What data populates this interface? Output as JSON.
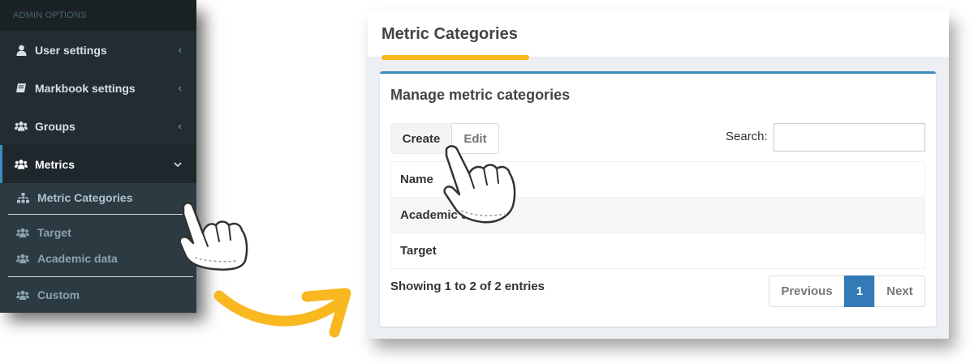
{
  "sidebar": {
    "header": "ADMIN OPTIONS",
    "items": [
      {
        "label": "User settings",
        "icon": "user-icon"
      },
      {
        "label": "Markbook settings",
        "icon": "book-icon"
      },
      {
        "label": "Groups",
        "icon": "users-icon"
      },
      {
        "label": "Metrics",
        "icon": "users-icon"
      }
    ],
    "sub_items": [
      {
        "label": "Metric Categories",
        "icon": "sitemap-icon"
      },
      {
        "label": "Target",
        "icon": "users-icon"
      },
      {
        "label": "Academic data",
        "icon": "users-icon"
      },
      {
        "label": "Custom",
        "icon": "users-icon"
      }
    ]
  },
  "main": {
    "page_title": "Metric Categories",
    "box_title": "Manage metric categories",
    "buttons": {
      "create": "Create",
      "edit": "Edit"
    },
    "search_label": "Search:",
    "search_value": "",
    "table": {
      "headers": [
        "Name"
      ],
      "rows": [
        [
          "Academic data"
        ],
        [
          "Target"
        ]
      ]
    },
    "info": "Showing 1 to 2 of 2 entries",
    "pagination": {
      "previous": "Previous",
      "current": "1",
      "next": "Next"
    }
  },
  "colors": {
    "sidebar_bg": "#222d32",
    "accent": "#3c8dbc",
    "highlight": "#f9b720",
    "page_active": "#337ab7"
  }
}
